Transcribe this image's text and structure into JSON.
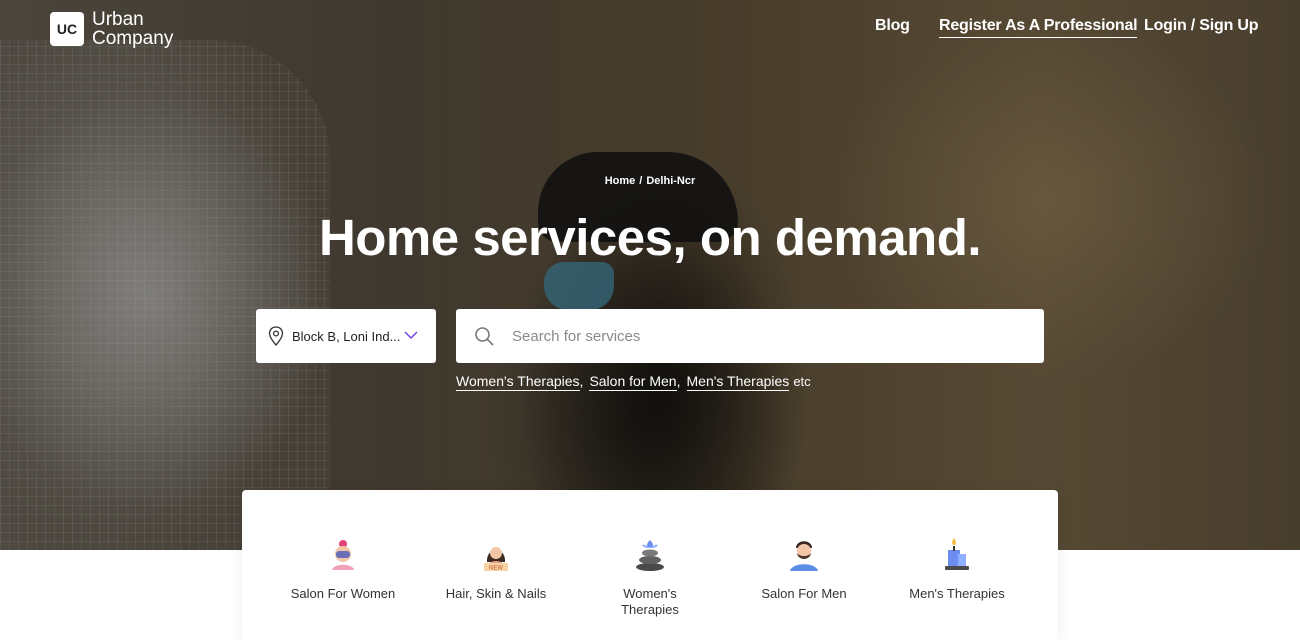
{
  "brand": {
    "mark": "UC",
    "name_line1": "Urban",
    "name_line2": "Company"
  },
  "nav": {
    "blog": "Blog",
    "register": "Register As A Professional",
    "login": "Login / Sign Up"
  },
  "breadcrumb": {
    "home": "Home",
    "separator": "/",
    "current": "Delhi-Ncr"
  },
  "hero": {
    "headline": "Home services, on demand."
  },
  "location": {
    "value": "Block B, Loni Ind..."
  },
  "search": {
    "placeholder": "Search for services"
  },
  "suggestions": {
    "items": [
      "Women's Therapies",
      "Salon for Men",
      "Men's Therapies"
    ],
    "etc": "etc"
  },
  "categories": [
    {
      "label": "Salon For Women",
      "icon": "salon-women-icon"
    },
    {
      "label": "Hair, Skin & Nails",
      "icon": "hair-skin-nails-icon",
      "badge": "NEW"
    },
    {
      "label": "Women's Therapies",
      "icon": "womens-therapies-icon"
    },
    {
      "label": "Salon For Men",
      "icon": "salon-men-icon"
    },
    {
      "label": "Men's Therapies",
      "icon": "mens-therapies-icon"
    }
  ],
  "colors": {
    "accent": "#6e42e5",
    "white": "#ffffff",
    "text": "#333333"
  }
}
